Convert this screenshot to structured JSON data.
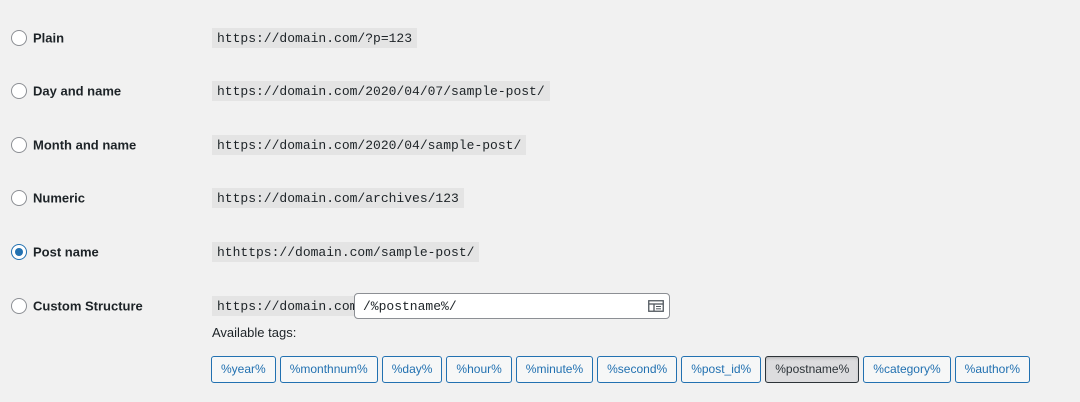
{
  "options": [
    {
      "label": "Plain",
      "example": "https://domain.com/?p=123",
      "checked": false
    },
    {
      "label": "Day and name",
      "example": "https://domain.com/2020/04/07/sample-post/",
      "checked": false
    },
    {
      "label": "Month and name",
      "example": "https://domain.com/2020/04/sample-post/",
      "checked": false
    },
    {
      "label": "Numeric",
      "example": "https://domain.com/archives/123",
      "checked": false
    },
    {
      "label": "Post name",
      "example": "hthttps://domain.com/sample-post/",
      "checked": true
    }
  ],
  "custom": {
    "label": "Custom Structure",
    "prefix": "https://domain.com",
    "value": "/%postname%/",
    "icon": "table-icon"
  },
  "available_tags_label": "Available tags:",
  "tags": [
    {
      "label": "%year%",
      "active": false
    },
    {
      "label": "%monthnum%",
      "active": false
    },
    {
      "label": "%day%",
      "active": false
    },
    {
      "label": "%hour%",
      "active": false
    },
    {
      "label": "%minute%",
      "active": false
    },
    {
      "label": "%second%",
      "active": false
    },
    {
      "label": "%post_id%",
      "active": false
    },
    {
      "label": "%postname%",
      "active": true
    },
    {
      "label": "%category%",
      "active": false
    },
    {
      "label": "%author%",
      "active": false
    }
  ],
  "colors": {
    "accent": "#2271b1",
    "background": "#f1f1f1",
    "code_background": "#e4e4e4"
  }
}
